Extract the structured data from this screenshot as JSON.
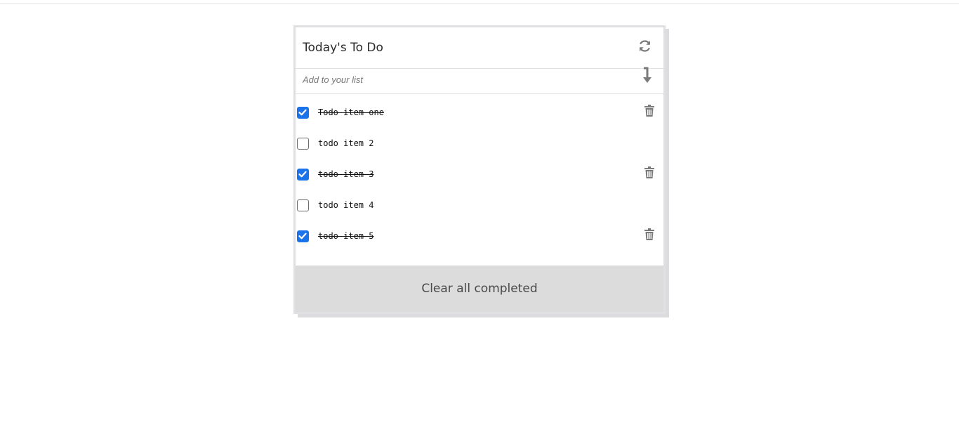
{
  "header": {
    "title": "Today's To Do",
    "refresh_icon": "refresh-icon"
  },
  "add_form": {
    "placeholder": "Add to your list",
    "value": "",
    "submit_icon": "arrow-down-return-icon"
  },
  "todos": [
    {
      "label": "Todo item one",
      "completed": true
    },
    {
      "label": "todo item 2",
      "completed": false
    },
    {
      "label": "todo item 3",
      "completed": true
    },
    {
      "label": "todo item 4",
      "completed": false
    },
    {
      "label": "todo item 5",
      "completed": true
    }
  ],
  "footer": {
    "clear_label": "Clear all completed"
  },
  "colors": {
    "checkbox_accent": "#1a73e8",
    "icon_gray": "#7a7a7a",
    "footer_bg": "#dcdcdd"
  }
}
